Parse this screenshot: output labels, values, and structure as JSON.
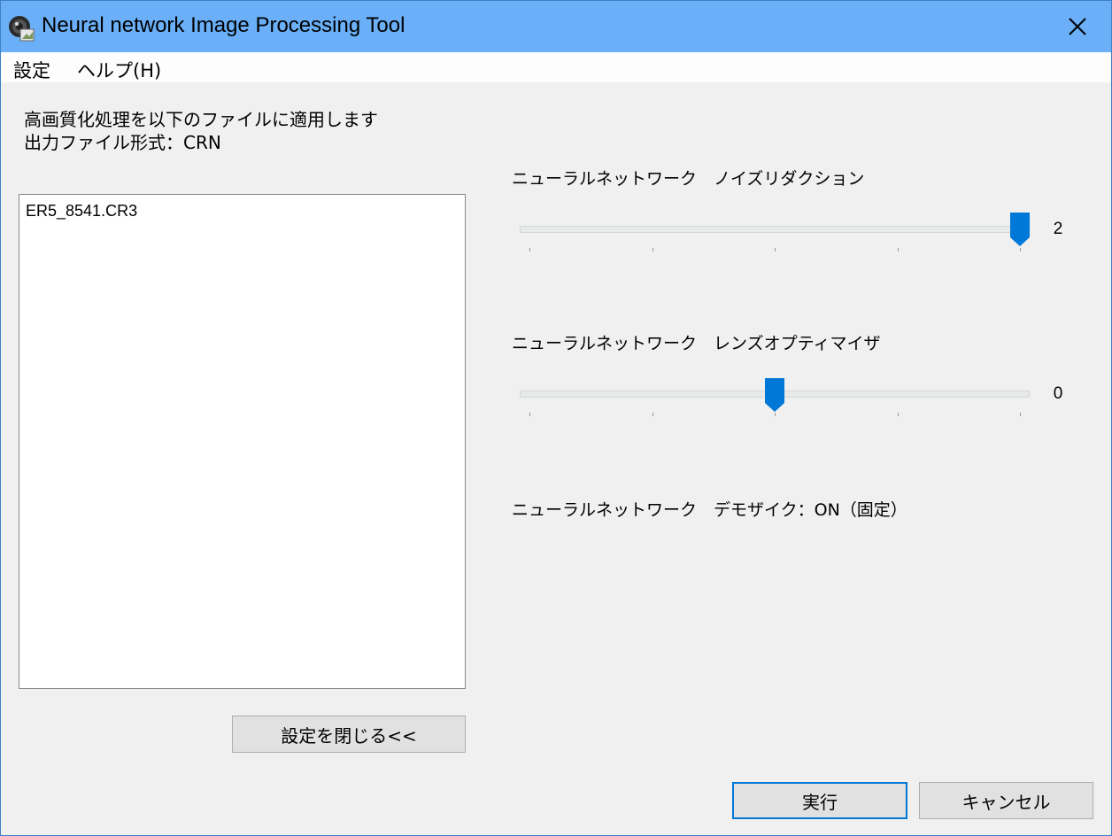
{
  "window": {
    "title": "Neural network Image Processing Tool",
    "app_icon": "camera-lens-icon",
    "close_icon": "close-icon"
  },
  "menu": {
    "settings": "設定",
    "help": "ヘルプ(H)"
  },
  "description": {
    "line1": "高画質化処理を以下のファイルに適用します",
    "line2": "出力ファイル形式：CRN"
  },
  "files": [
    "ER5_8541.CR3"
  ],
  "sliders": [
    {
      "label": "ニューラルネットワーク　ノイズリダクション",
      "value": "2",
      "position_fraction": 1.0,
      "tick_count": 5
    },
    {
      "label": "ニューラルネットワーク　レンズオプティマイザ",
      "value": "0",
      "position_fraction": 0.5,
      "tick_count": 5
    }
  ],
  "demosaic_label": "ニューラルネットワーク　デモザイク：ON（固定）",
  "buttons": {
    "close_settings": "設定を閉じる<<",
    "run": "実行",
    "cancel": "キャンセル"
  },
  "colors": {
    "titlebar": "#6aaff7",
    "accent": "#0078d7"
  }
}
